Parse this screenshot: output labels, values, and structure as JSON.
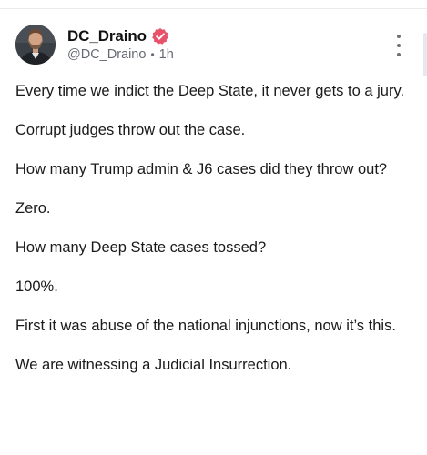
{
  "post": {
    "author": {
      "display_name": "DC_Draino",
      "handle": "@DC_Draino",
      "time_ago": "1h",
      "separator": "•",
      "verified": true,
      "verified_color": "#e8516a"
    },
    "paragraphs": [
      "Every time we indict the Deep State, it never gets to a jury.",
      "Corrupt judges throw out the case.",
      "How many Trump admin & J6 cases did they throw out?",
      "Zero.",
      "How many Deep State cases tossed?",
      "100%.",
      "First it was abuse of the national injunctions, now it’s this.",
      "We are witnessing a Judicial Insurrection."
    ],
    "menu_icon": "more-vertical-icon"
  }
}
